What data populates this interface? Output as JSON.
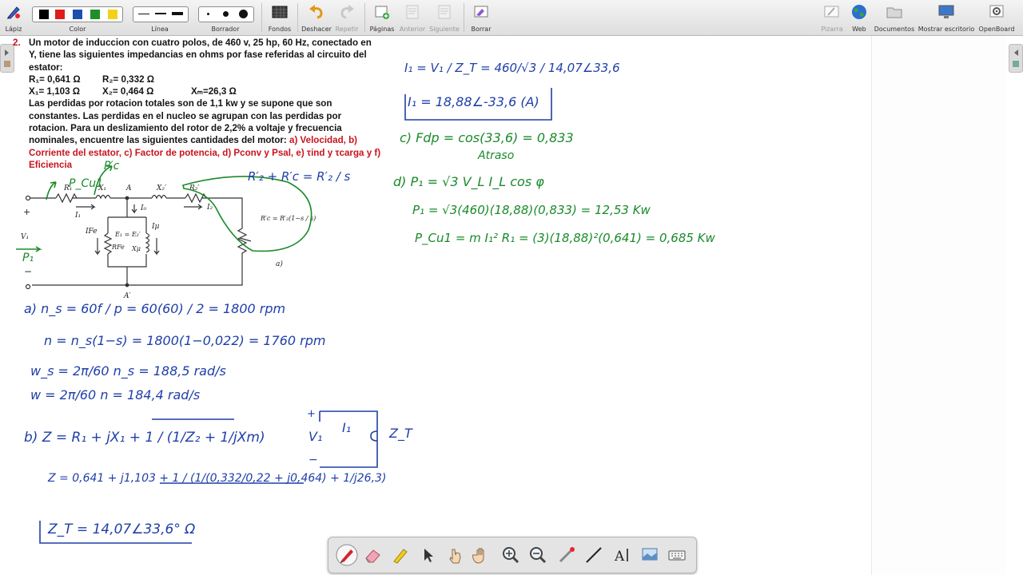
{
  "toolbar": {
    "pencil_label": "Lápiz",
    "color_label": "Color",
    "line_label": "Línea",
    "eraser_label": "Borrador",
    "backgrounds_label": "Fondos",
    "undo_label": "Deshacer",
    "redo_label": "Repetir",
    "pages_label": "Páginas",
    "prev_label": "Anterior",
    "next_label": "Siguiente",
    "clear_label": "Borrar",
    "whiteboard_label": "Pizarra",
    "web_label": "Web",
    "documents_label": "Documentos",
    "desktop_label": "Mostrar escritorio",
    "openboard_label": "OpenBoard"
  },
  "colors": {
    "swatches": [
      "#000000",
      "#e01b1b",
      "#1c4fb0",
      "#1e8f2a",
      "#f2d11a"
    ],
    "ink_blue": "#1f3fa8",
    "ink_green": "#1a8a2a",
    "problem_red": "#c8141d"
  },
  "problem": {
    "number": "2.",
    "line1": "Un motor de induccion con cuatro polos, de 460 v, 25 hp, 60 Hz, conectado en",
    "line2": "Y, tiene las siguientes impedancias en ohms por fase referidas al circuito del",
    "line3": "estator:",
    "r1": "R₁= 0,641 Ω",
    "r2": "R₂= 0,332 Ω",
    "x1": "X₁= 1,103 Ω",
    "x2": "X₂= 0,464 Ω",
    "xm": "Xₘ=26,3 Ω",
    "line4": "Las perdidas por rotacion totales son de 1,1 kw y se supone que son",
    "line5": "constantes. Las perdidas en el nucleo se agrupan con las perdidas por",
    "line6": "rotacion. Para un deslizamiento del rotor de 2,2% a voltaje y frecuencia",
    "line7": "nominales, encuentre las siguientes cantidades del motor:",
    "q_a": " a) Velocidad, b)",
    "q_b": "Corriente del estator, c) Factor de potencia, d) Pconv y Psal, e) τind y τcarga y f)",
    "q_f": "Eficiencia"
  },
  "circuit": {
    "r1": "R₁",
    "x1": "X₁",
    "node_a": "A",
    "x2": "X₂′",
    "r2": "R₂′",
    "i1": "I₁",
    "i0": "I₀",
    "i2": "I₂",
    "ife": "IFe",
    "imu": "Iμ",
    "e1": "E₁ = E₂′",
    "rfe": "RFe",
    "xmu": "Xμ",
    "rc": "R′c = R′₂(1−s / s)",
    "v1": "V₁",
    "plus": "+",
    "minus": "−",
    "node_a2": "A′",
    "fig": "a)"
  },
  "handwriting": {
    "i1_eq": "I₁ = V₁ / Z_T = 460/√3 / 14,07∠33,6",
    "i1_result": "I₁ = 18,88∠-33,6 (A)",
    "c_fdp": "c) Fdp = cos(33,6) = 0,833",
    "atraso": "Atraso",
    "d_p1": "d) P₁ = √3 V_L I_L cos φ",
    "d_p1_val": "P₁ = √3(460)(18,88)(0,833) = 12,53 Kw",
    "d_pcu": "P_Cu1 = m I₁² R₁ = (3)(18,88)²(0,641) = 0,685 Kw",
    "pcu_label": "P_Cu1",
    "pc_label": "P′c",
    "formula_r2": "R′₂ + R′c = R′₂ / s",
    "p1_label": "P₁",
    "a_ns": "a) n_s = 60f / p = 60(60) / 2 = 1800 rpm",
    "a_n": "n = n_s(1−s) = 1800(1−0,022) = 1760 rpm",
    "a_ws": "w_s = 2π/60 n_s = 188,5 rad/s",
    "a_w": "w = 2π/60 n = 184,4 rad/s",
    "b_z": "b) Z = R₁ + jX₁ + 1 / (1/Z₂ + 1/jXm)",
    "b_z_val": "Z = 0,641 + j1,103 + 1 / (1/(0,332/0,22 + j0,464) + 1/j26,3)",
    "zt": "Z_T = 14,07∠33,6° Ω",
    "sub_v1": "V₁",
    "sub_i1": "I₁",
    "sub_zt": "Z_T",
    "sub_plus": "+",
    "sub_minus": "−"
  },
  "bottom_toolbar": {
    "tools": [
      "pen-icon",
      "eraser-icon",
      "highlighter-icon",
      "pointer-icon",
      "selector-icon",
      "hand-icon",
      "zoom-in-icon",
      "zoom-out-icon",
      "laser-icon",
      "line-icon",
      "text-icon",
      "capture-icon",
      "keyboard-icon"
    ]
  }
}
